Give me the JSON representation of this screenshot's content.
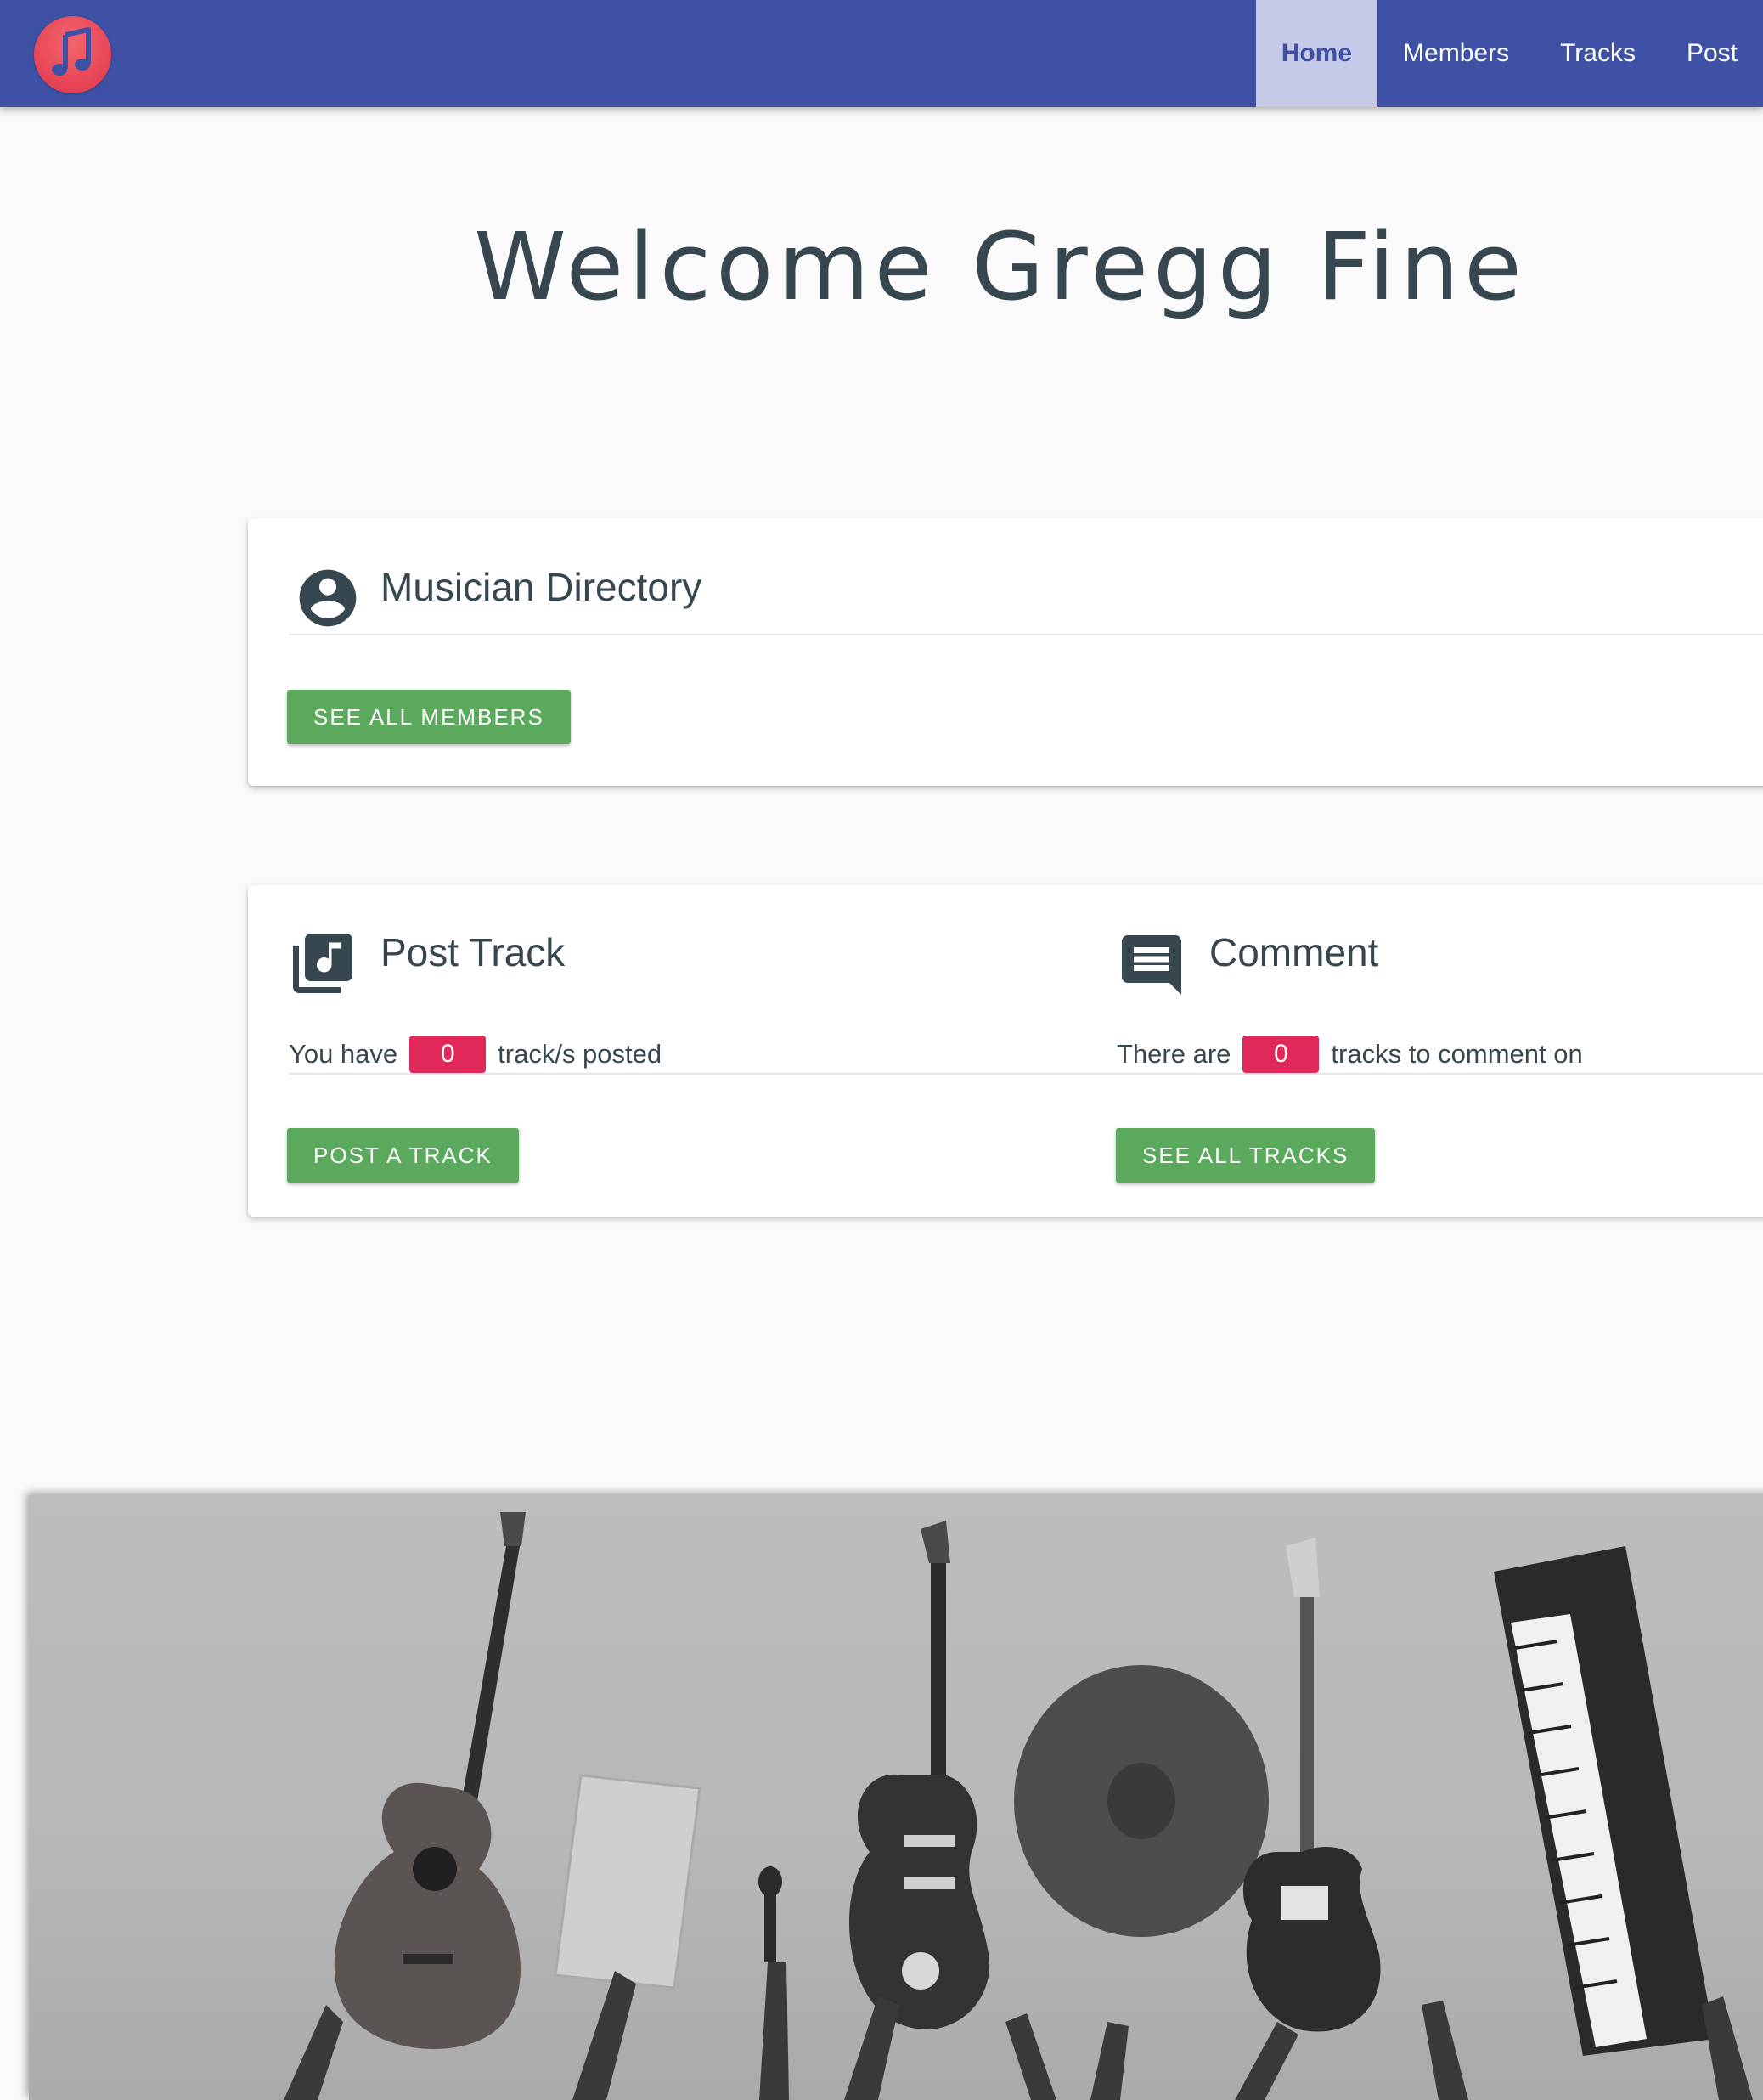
{
  "navbar": {
    "logo_icon": "music-note-icon",
    "items": [
      {
        "label": "Home",
        "active": true
      },
      {
        "label": "Members",
        "active": false
      },
      {
        "label": "Tracks",
        "active": false
      },
      {
        "label": "Post",
        "active": false
      }
    ]
  },
  "welcome": {
    "title": "Welcome Gregg Fine"
  },
  "directory": {
    "icon": "account-circle-icon",
    "title": "Musician Directory",
    "button_label": "SEE ALL MEMBERS"
  },
  "post_track": {
    "icon": "library-music-icon",
    "title": "Post Track",
    "prefix": "You have",
    "count": "0",
    "suffix": "track/s posted",
    "button_label": "POST A TRACK"
  },
  "comment": {
    "icon": "comment-icon",
    "title": "Comment",
    "prefix": "There are",
    "count": "0",
    "suffix": "tracks to comment on",
    "button_label": "SEE ALL TRACKS"
  },
  "hero": {
    "image_subject": "hands holding up instruments"
  },
  "colors": {
    "navbar": "#3f51a5",
    "nav_active_bg": "#c5cae9",
    "button": "#5aa95d",
    "badge": "#e0285a",
    "logo": "#e94a59"
  }
}
